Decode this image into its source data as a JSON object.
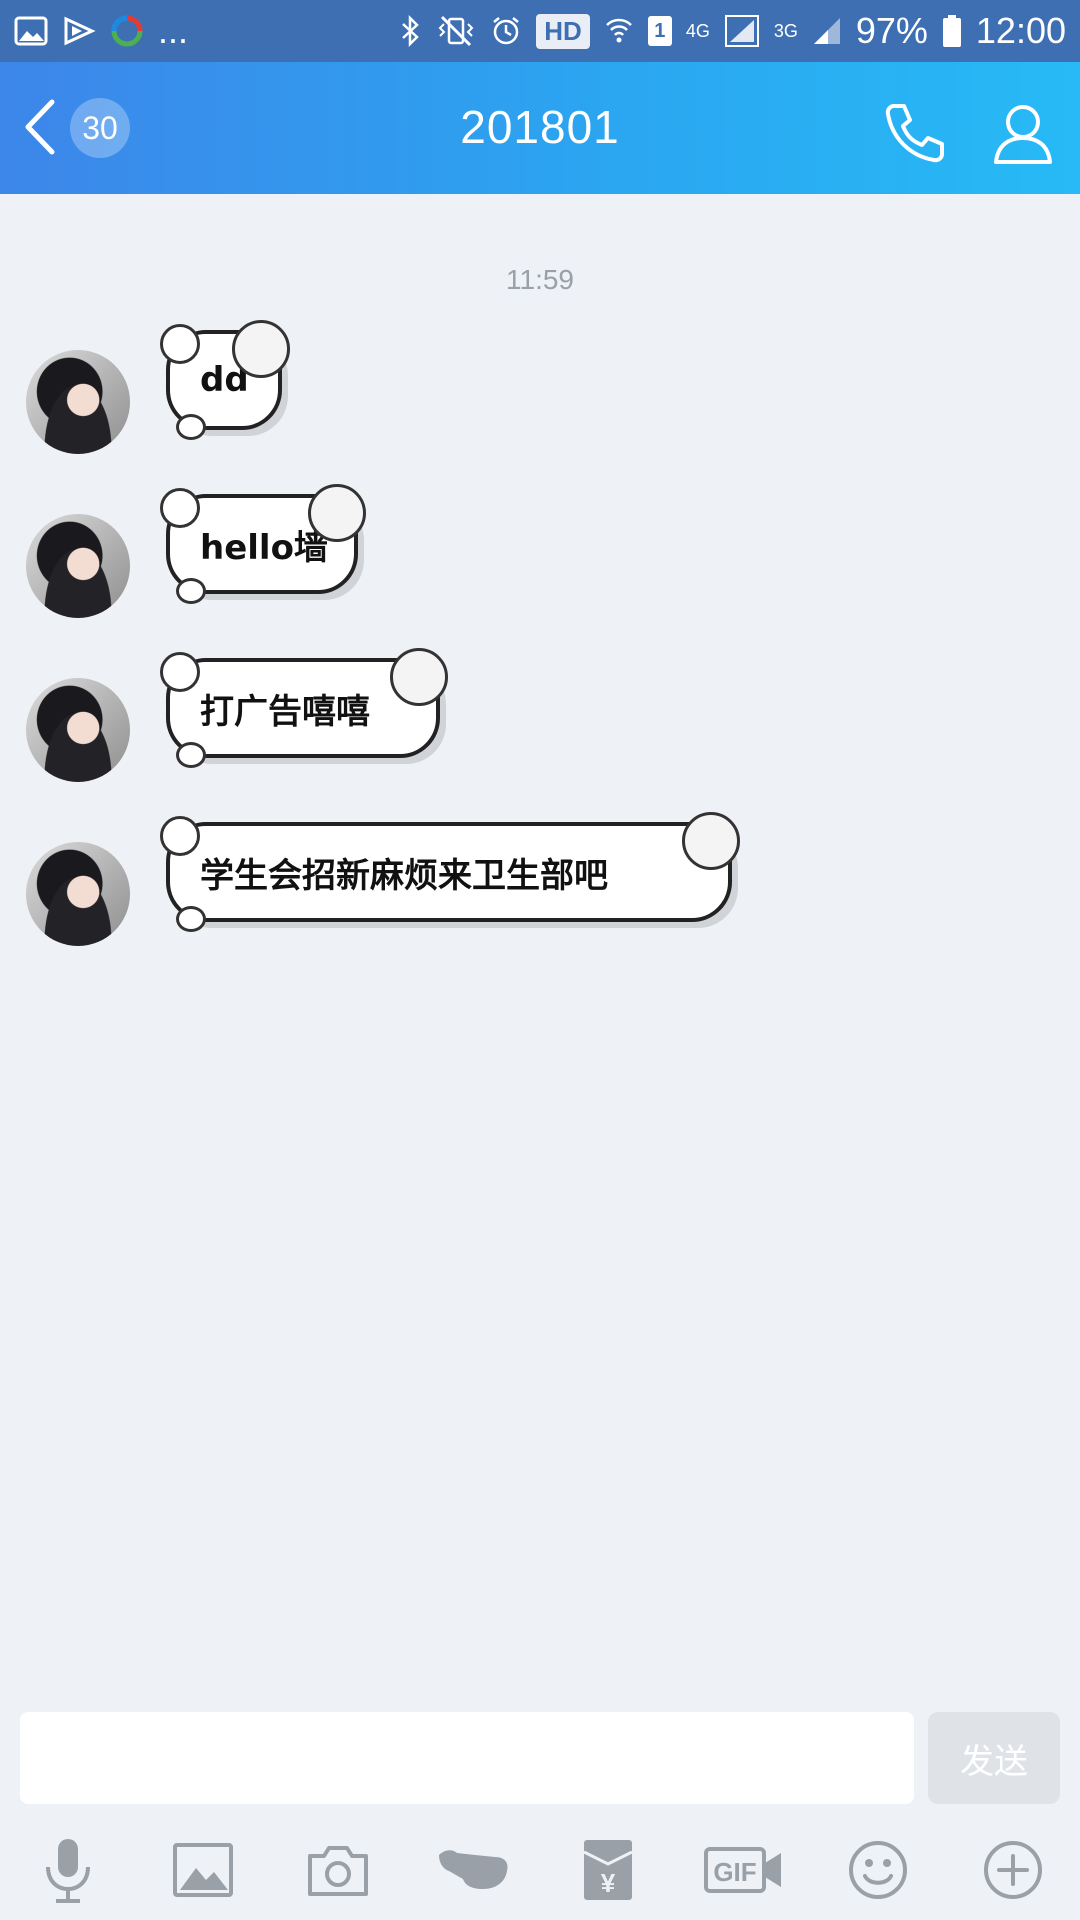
{
  "status_bar": {
    "more_indicator": "...",
    "hd_label": "HD",
    "sim_label": "1",
    "network_4g": "4G",
    "network_3g": "3G",
    "battery": "97%",
    "time": "12:00"
  },
  "header": {
    "unread_badge": "30",
    "title": "201801"
  },
  "chat": {
    "timestamp": "11:59",
    "messages": [
      {
        "text": "dd"
      },
      {
        "text": "hello墙"
      },
      {
        "text": "打广告嘻嘻"
      },
      {
        "text": "学生会招新麻烦来卫生部吧"
      }
    ]
  },
  "composer": {
    "input_value": "",
    "send_label": "发送"
  },
  "toolbar": {
    "items": [
      "microphone-icon",
      "image-icon",
      "camera-icon",
      "poke-icon",
      "red-packet-icon",
      "gif-icon",
      "emoji-icon",
      "plus-icon"
    ],
    "gif_label": "GIF",
    "yen_label": "¥"
  },
  "colors": {
    "header_start": "#3d86ea",
    "header_end": "#27baf6",
    "background": "#eef1f5",
    "send_disabled": "#dfe3e8"
  }
}
